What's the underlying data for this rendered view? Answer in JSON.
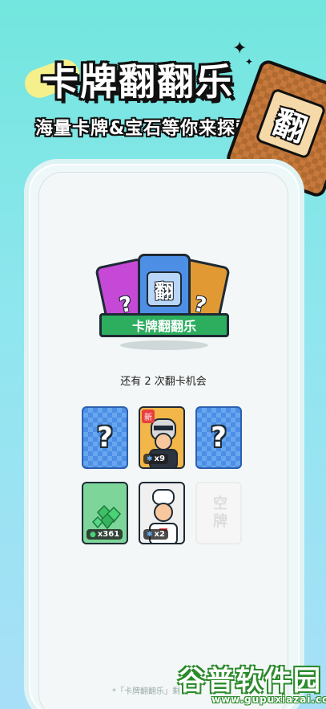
{
  "hero": {
    "title": "卡牌翻翻乐",
    "subtitle": "海量卡牌&宝石等你来探索",
    "card_char": "翻"
  },
  "logo": {
    "banner": "卡牌翻翻乐",
    "center_char": "翻",
    "side_char": "?"
  },
  "status": {
    "chance_text": "还有 2 次翻卡机会"
  },
  "cards": [
    {
      "type": "mystery",
      "symbol": "?"
    },
    {
      "type": "character",
      "badge": "新",
      "count": "x9"
    },
    {
      "type": "mystery",
      "symbol": "?"
    },
    {
      "type": "gem",
      "count": "x361"
    },
    {
      "type": "character",
      "count": "x2"
    },
    {
      "type": "empty",
      "label": "空牌"
    }
  ],
  "footer": {
    "note": "*「卡牌翻翻乐」剩"
  },
  "watermark": {
    "cn": "谷普软件园",
    "en": "www.gupuxiazai.com"
  },
  "colors": {
    "bg_top": "#72e6de",
    "card_blue": "#4b8fe6",
    "banner_green": "#2dae5f"
  }
}
